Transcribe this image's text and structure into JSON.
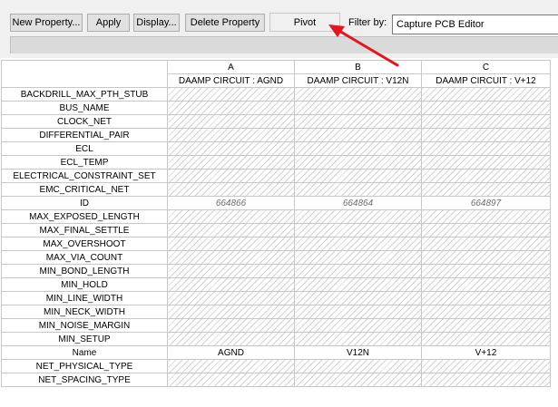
{
  "toolbar": {
    "new_property": "New Property...",
    "apply": "Apply",
    "display": "Display...",
    "delete_property": "Delete Property",
    "pivot": "Pivot",
    "filter_label": "Filter by:",
    "filter_value": "Capture PCB Editor"
  },
  "annotation": {
    "arrow_color": "#e8131b"
  },
  "grid": {
    "columns": [
      {
        "letter": "A",
        "net": "DAAMP CIRCUIT : AGND"
      },
      {
        "letter": "B",
        "net": "DAAMP CIRCUIT : V12N"
      },
      {
        "letter": "C",
        "net": "DAAMP CIRCUIT : V+12"
      }
    ],
    "rows": [
      {
        "name": "BACKDRILL_MAX_PTH_STUB",
        "values": [
          "",
          "",
          ""
        ]
      },
      {
        "name": "BUS_NAME",
        "values": [
          "",
          "",
          ""
        ]
      },
      {
        "name": "CLOCK_NET",
        "values": [
          "",
          "",
          ""
        ]
      },
      {
        "name": "DIFFERENTIAL_PAIR",
        "values": [
          "",
          "",
          ""
        ]
      },
      {
        "name": "ECL",
        "values": [
          "",
          "",
          ""
        ]
      },
      {
        "name": "ECL_TEMP",
        "values": [
          "",
          "",
          ""
        ]
      },
      {
        "name": "ELECTRICAL_CONSTRAINT_SET",
        "values": [
          "",
          "",
          ""
        ]
      },
      {
        "name": "EMC_CRITICAL_NET",
        "values": [
          "",
          "",
          ""
        ]
      },
      {
        "name": "ID",
        "values": [
          "664866",
          "664864",
          "664897"
        ],
        "style": "italic"
      },
      {
        "name": "MAX_EXPOSED_LENGTH",
        "values": [
          "",
          "",
          ""
        ]
      },
      {
        "name": "MAX_FINAL_SETTLE",
        "values": [
          "",
          "",
          ""
        ]
      },
      {
        "name": "MAX_OVERSHOOT",
        "values": [
          "",
          "",
          ""
        ]
      },
      {
        "name": "MAX_VIA_COUNT",
        "values": [
          "",
          "",
          ""
        ]
      },
      {
        "name": "MIN_BOND_LENGTH",
        "values": [
          "",
          "",
          ""
        ]
      },
      {
        "name": "MIN_HOLD",
        "values": [
          "",
          "",
          ""
        ]
      },
      {
        "name": "MIN_LINE_WIDTH",
        "values": [
          "",
          "",
          ""
        ]
      },
      {
        "name": "MIN_NECK_WIDTH",
        "values": [
          "",
          "",
          ""
        ]
      },
      {
        "name": "MIN_NOISE_MARGIN",
        "values": [
          "",
          "",
          ""
        ]
      },
      {
        "name": "MIN_SETUP",
        "values": [
          "",
          "",
          ""
        ]
      },
      {
        "name": "Name",
        "values": [
          "AGND",
          "V12N",
          "V+12"
        ],
        "style": "plain"
      },
      {
        "name": "NET_PHYSICAL_TYPE",
        "values": [
          "",
          "",
          ""
        ]
      },
      {
        "name": "NET_SPACING_TYPE",
        "values": [
          "",
          "",
          ""
        ]
      }
    ]
  }
}
